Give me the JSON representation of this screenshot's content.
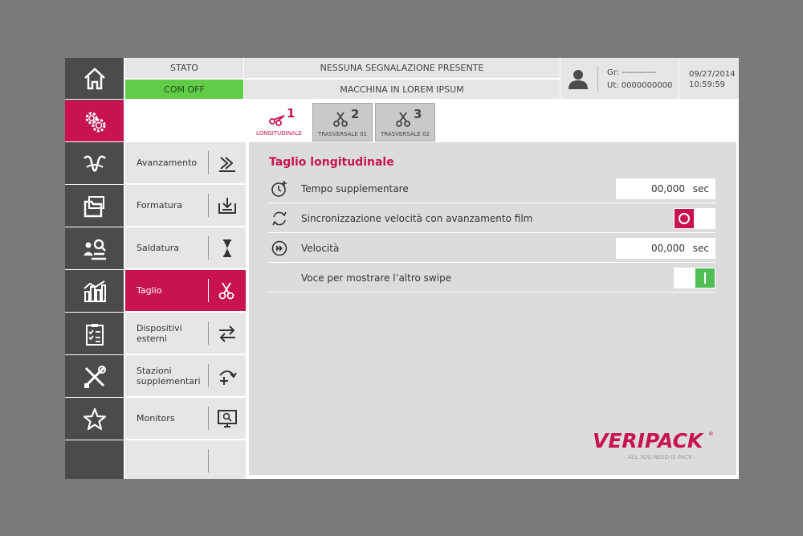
{
  "header": {
    "stato_label": "STATO",
    "stato_value": "COM OFF",
    "message_top": "NESSUNA SEGNALAZIONE PRESENTE",
    "message_bottom": "MACCHINA IN LOREM IPSUM",
    "user_gr": "Gr: ------------",
    "user_ut": "Ut: 0000000000",
    "date": "09/27/2014",
    "time": "10:59:59"
  },
  "rail": {
    "items": [
      {
        "icon": "home-icon"
      },
      {
        "icon": "gear-icon",
        "active": true
      },
      {
        "icon": "wrapping-icon"
      },
      {
        "icon": "folder-icon"
      },
      {
        "icon": "users-search-icon"
      },
      {
        "icon": "bar-chart-icon"
      },
      {
        "icon": "checklist-icon"
      },
      {
        "icon": "tools-icon"
      },
      {
        "icon": "star-icon"
      }
    ]
  },
  "submenu": {
    "items": [
      {
        "label": "Avanzamento",
        "icon": "fast-forward-icon"
      },
      {
        "label": "Formatura",
        "icon": "tray-download-icon"
      },
      {
        "label": "Saldatura",
        "icon": "hourglass-icon"
      },
      {
        "label": "Taglio",
        "icon": "scissors-icon",
        "active": true
      },
      {
        "label": "Dispositivi\nesterni",
        "icon": "swap-arrows-icon"
      },
      {
        "label": "Stazioni\nsupplementari",
        "icon": "add-arrow-icon"
      },
      {
        "label": "Monitors",
        "icon": "monitor-search-icon"
      },
      {
        "label": "",
        "icon": ""
      }
    ]
  },
  "tabs": [
    {
      "number": "1",
      "label": "LONGITUDINALE",
      "active": true
    },
    {
      "number": "2",
      "label": "TRASVERSALE 01"
    },
    {
      "number": "3",
      "label": "TRASVERSALE 02"
    }
  ],
  "panel": {
    "title": "Taglio longitudinale",
    "rows": [
      {
        "icon": "timer-plus-icon",
        "label": "Tempo supplementare",
        "value": "00,000",
        "unit": "sec"
      },
      {
        "icon": "sync-icon",
        "label": "Sincronizzazione velocità con avanzamento film",
        "toggle": "off"
      },
      {
        "icon": "speed-icon",
        "label": "Velocità",
        "value": "00,000",
        "unit": "sec"
      },
      {
        "icon": "",
        "label": "Voce per mostrare l’altro swipe",
        "toggle": "on"
      }
    ]
  },
  "logo": {
    "brand": "VERIPACK",
    "registered": "®",
    "tagline": "ALL YOU NEED IS PACK"
  },
  "colors": {
    "accent": "#c8134e",
    "status_green": "#60cc48",
    "toggle_on": "#4fbf55",
    "rail_bg": "#4b4b4b",
    "panel_bg": "#dcdcdc"
  }
}
